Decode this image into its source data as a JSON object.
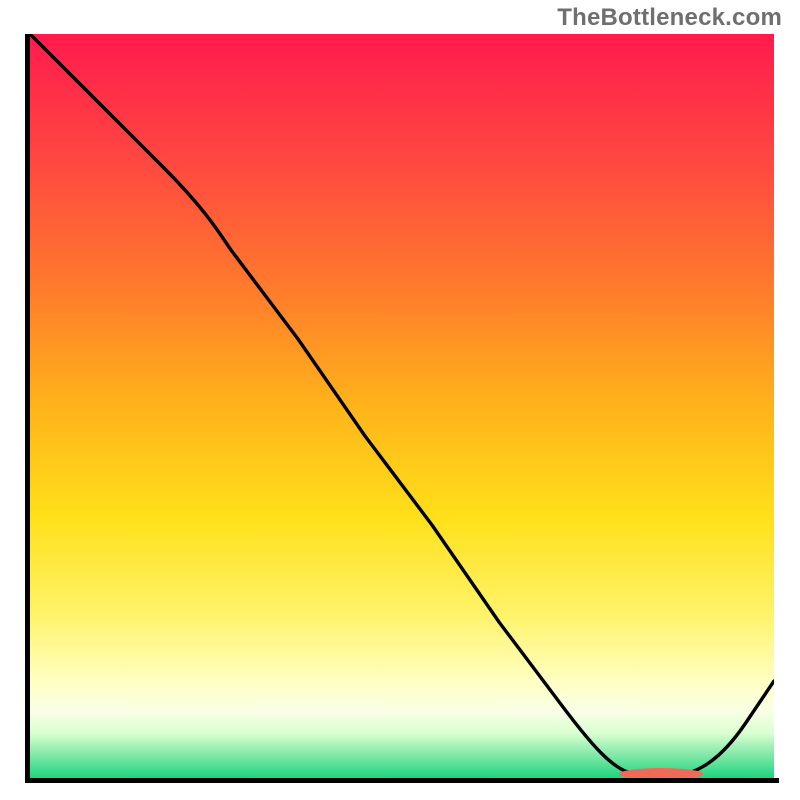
{
  "watermark": "TheBottleneck.com",
  "colors": {
    "curve": "#000000",
    "marker": "#f06a5a",
    "gradient_top": "#ff1b4d",
    "gradient_mid": "#ffe01a",
    "gradient_bottom": "#1bd67f"
  },
  "chart_data": {
    "type": "line",
    "title": "",
    "xlabel": "",
    "ylabel": "",
    "xlim": [
      0,
      100
    ],
    "ylim": [
      0,
      100
    ],
    "x": [
      0,
      9,
      18,
      27,
      36,
      45,
      54,
      63,
      72,
      80,
      86,
      92,
      100
    ],
    "values": [
      100,
      91,
      82,
      72,
      59,
      46,
      34,
      21,
      9,
      1,
      0,
      2,
      13
    ],
    "minimum_region": {
      "x_start": 80,
      "x_end": 92,
      "y": 0
    },
    "annotations": [
      {
        "text": "TheBottleneck.com",
        "position": "top-right"
      }
    ]
  }
}
